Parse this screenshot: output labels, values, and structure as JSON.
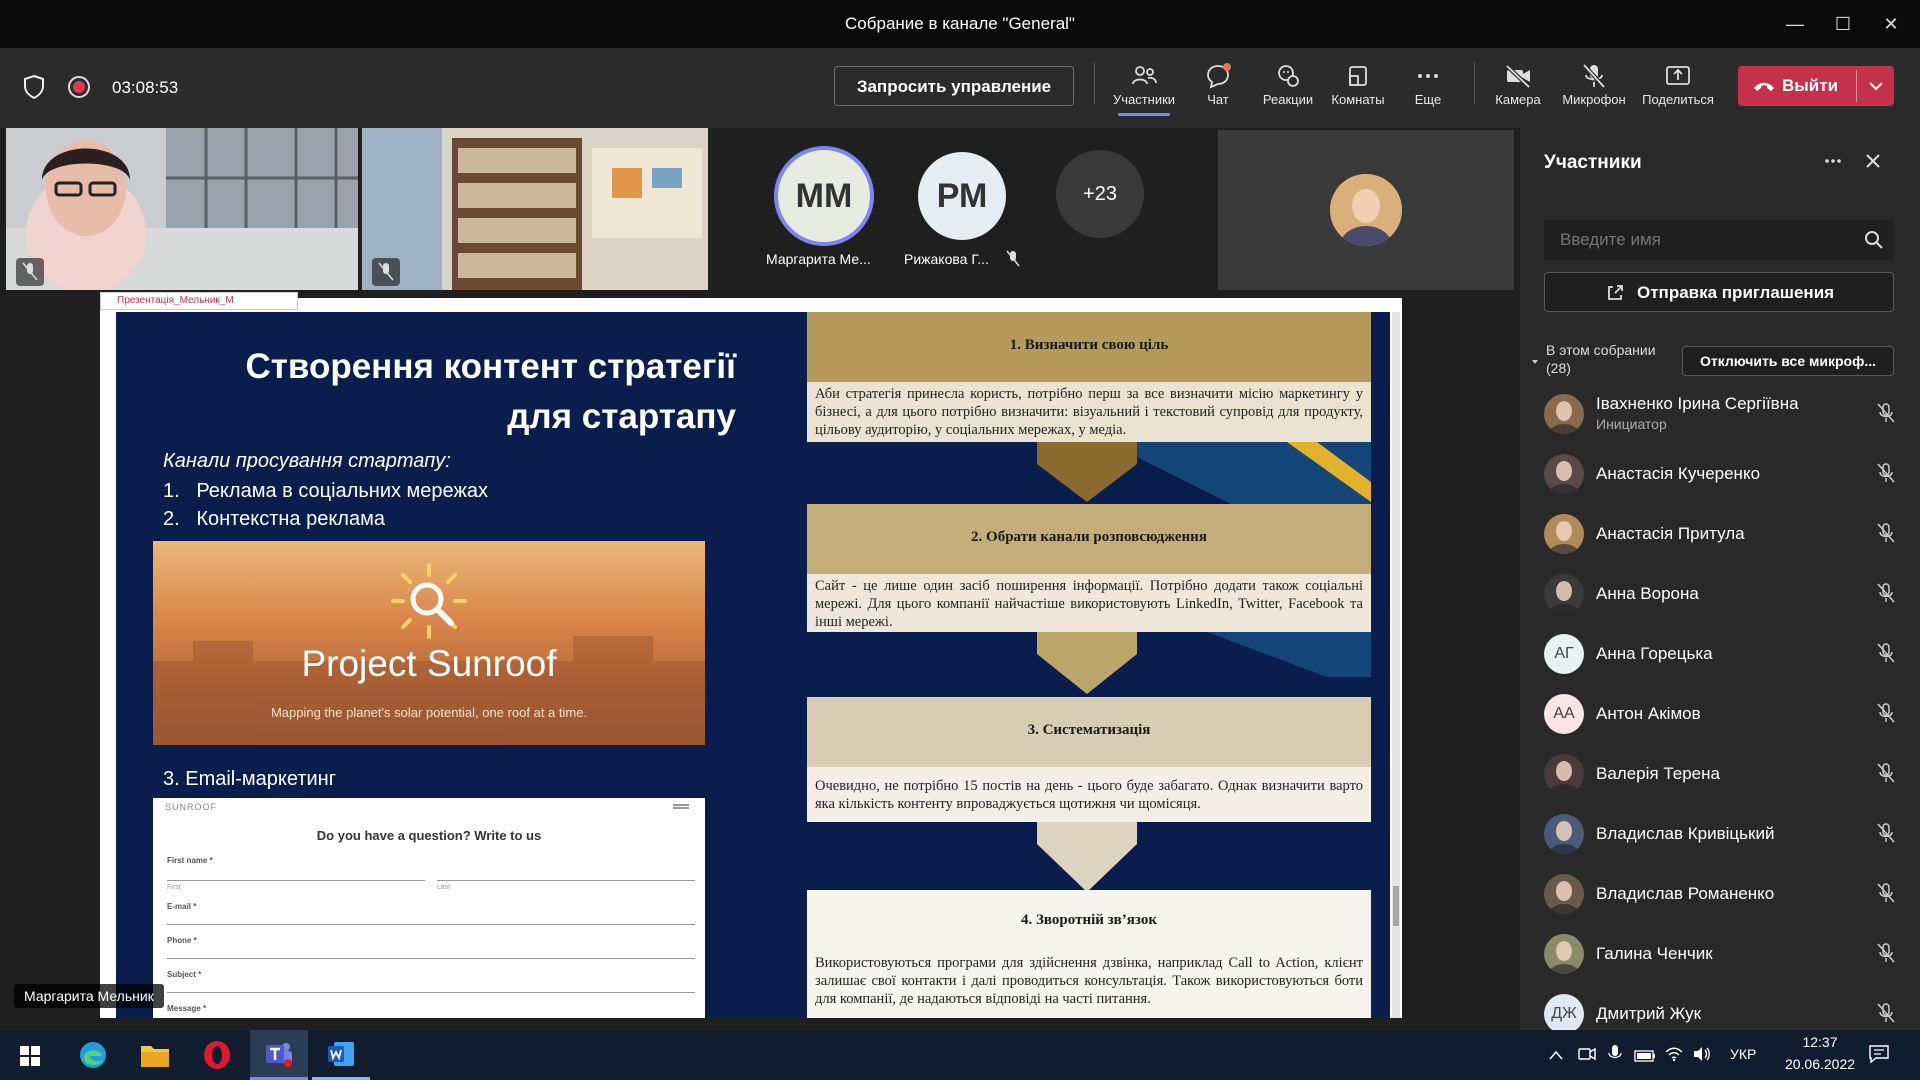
{
  "window": {
    "title": "Собрание в канале \"General\""
  },
  "meeting": {
    "timer": "03:08:53",
    "request_control": "Запросить управление",
    "toolbar": [
      "Участники",
      "Чат",
      "Реакции",
      "Комнаты",
      "Еще",
      "Камера",
      "Микрофон",
      "Поделиться"
    ],
    "leave": "Выйти"
  },
  "videos": {
    "avatar1": {
      "initials": "ММ",
      "name": "Маргарита Ме..."
    },
    "avatar2": {
      "initials": "РМ",
      "name": "Рижакова Г..."
    },
    "more": "+23",
    "speaker_label": "Маргарита Мельник",
    "tab_label": "Презентація_Мельник_М"
  },
  "slide": {
    "title": "Створення контент стратегії для стартапу",
    "subtitle": "Канали просування стартапу:",
    "channels": [
      "1.   Реклама в соціальних мережах",
      "2.   Контекстна реклама"
    ],
    "sunroof_title": "Project Sunroof",
    "sunroof_sub": "Mapping the planet's solar potential, one roof at a time.",
    "email_heading": "3. Email-маркетинг",
    "form": {
      "logo": "SUNROOF",
      "heading": "Do you have a question? Write to us",
      "first_name": "First name *",
      "first": "First",
      "last": "Last",
      "email": "E-mail *",
      "phone": "Phone *",
      "subject": "Subject *",
      "message": "Message *"
    },
    "steps": [
      {
        "title": "1. Визначити свою ціль",
        "text": "Аби стратегія принесла користь, потрібно перш за все визначити місію маркетингу у бізнесі, а для цього потрібно визначити: візуальний і текстовий супровід для продукту, цільову аудиторію, у соціальних мережах, у медіа."
      },
      {
        "title": "2. Обрати канали розповсюдження",
        "text": "Сайт - це лише один засіб поширення інформації. Потрібно додати також соціальні мережі. Для цього компанії найчастіше використовують LinkedIn, Twitter, Facebook та інші мережі."
      },
      {
        "title": "3. Систематизація",
        "text": "Очевидно, не потрібно 15 постів на день - цього буде забагато. Однак визначити варто яка кількість контенту впроваджується щотижня чи щомісяця."
      },
      {
        "title": "4. Зворотній зв’язок",
        "text": "Використовуються програми для здійснення дзвінка, наприклад Call to Action, клієнт залишає свої контакти і далі проводиться консультація. Також використовуються боти для компанії, де надаються відповіді на часті питання."
      }
    ]
  },
  "panel": {
    "title": "Участники",
    "search_placeholder": "Введите имя",
    "invite": "Отправка приглашения",
    "section": "В этом собрании",
    "count": "(28)",
    "mute_all": "Отключить все микроф...",
    "participants": [
      {
        "name": "Івахненко Ірина Сергіївна",
        "role": "Инициатор",
        "initials": "",
        "color": "#8a6a4a"
      },
      {
        "name": "Анастасія Кучеренко",
        "initials": "",
        "color": "#5a4a48"
      },
      {
        "name": "Анастасія Притула",
        "initials": "",
        "color": "#b08a5a"
      },
      {
        "name": "Анна Ворона",
        "initials": "",
        "color": "#3a3a3a"
      },
      {
        "name": "Анна Горецька",
        "initials": "АГ",
        "color": "#e6f4f1"
      },
      {
        "name": "Антон Акімов",
        "initials": "АА",
        "color": "#fbe4e4"
      },
      {
        "name": "Валерія Терена",
        "initials": "",
        "color": "#4a3a3a"
      },
      {
        "name": "Владислав Кривіцький",
        "initials": "",
        "color": "#4a5a7a"
      },
      {
        "name": "Владислав Романенко",
        "initials": "",
        "color": "#6a5a4a"
      },
      {
        "name": "Галина Ченчик",
        "initials": "",
        "color": "#8a8a6a"
      },
      {
        "name": "Дмитрий Жук",
        "initials": "ДЖ",
        "color": "#e0e8f6"
      }
    ]
  },
  "taskbar": {
    "lang": "УКР",
    "time": "12:37",
    "date": "20.06.2022"
  }
}
